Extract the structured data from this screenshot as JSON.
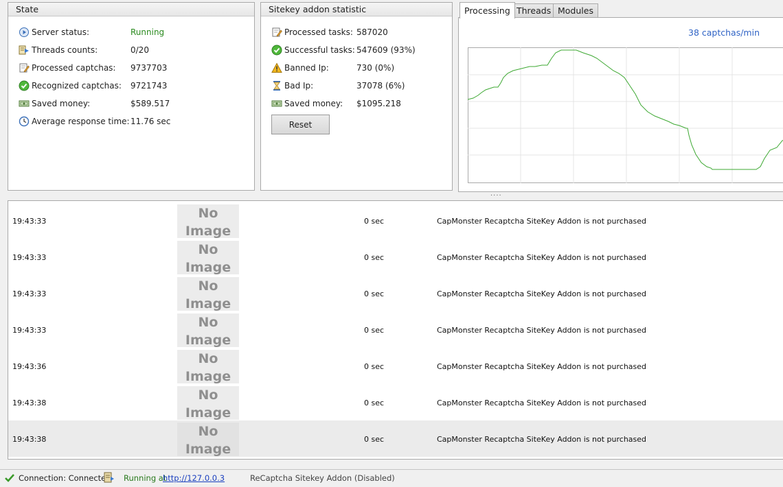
{
  "state": {
    "title": "State",
    "stats": [
      {
        "icon": "play-circle-icon",
        "label": "Server status:",
        "value": "Running"
      },
      {
        "icon": "threads-icon",
        "label": "Threads counts:",
        "value": "0/20"
      },
      {
        "icon": "edit-document-icon",
        "label": "Processed captchas:",
        "value": "9737703"
      },
      {
        "icon": "check-circle-icon",
        "label": "Recognized captchas:",
        "value": "9721743"
      },
      {
        "icon": "money-icon",
        "label": "Saved money:",
        "value": "$589.517"
      },
      {
        "icon": "clock-icon",
        "label": "Average response time:",
        "value": "11.76 sec"
      }
    ]
  },
  "sitekey": {
    "title": "Sitekey addon statistic",
    "stats": [
      {
        "icon": "edit-document-icon",
        "label": "Processed tasks:",
        "value": "587020"
      },
      {
        "icon": "check-circle-icon",
        "label": "Successful tasks:",
        "value": "547609 (93%)"
      },
      {
        "icon": "warning-icon",
        "label": "Banned Ip:",
        "value": "730 (0%)"
      },
      {
        "icon": "hourglass-icon",
        "label": "Bad Ip:",
        "value": "37078 (6%)"
      },
      {
        "icon": "money-icon",
        "label": "Saved money:",
        "value": "$1095.218"
      }
    ],
    "reset_label": "Reset"
  },
  "tabs": [
    {
      "label": "Processing",
      "active": true
    },
    {
      "label": "Threads",
      "active": false
    },
    {
      "label": "Modules",
      "active": false
    }
  ],
  "processing": {
    "rate": "38 captchas/min"
  },
  "splitter": "....",
  "log": {
    "no_image_line1": "No",
    "no_image_line2": "Image",
    "rows": [
      {
        "time": "19:43:33",
        "duration": "0 sec",
        "message": "CapMonster Recaptcha SiteKey Addon is not purchased"
      },
      {
        "time": "19:43:33",
        "duration": "0 sec",
        "message": "CapMonster Recaptcha SiteKey Addon is not purchased"
      },
      {
        "time": "19:43:33",
        "duration": "0 sec",
        "message": "CapMonster Recaptcha SiteKey Addon is not purchased"
      },
      {
        "time": "19:43:33",
        "duration": "0 sec",
        "message": "CapMonster Recaptcha SiteKey Addon is not purchased"
      },
      {
        "time": "19:43:36",
        "duration": "0 sec",
        "message": "CapMonster Recaptcha SiteKey Addon is not purchased"
      },
      {
        "time": "19:43:38",
        "duration": "0 sec",
        "message": "CapMonster Recaptcha SiteKey Addon is not purchased"
      },
      {
        "time": "19:43:38",
        "duration": "0 sec",
        "message": "CapMonster Recaptcha SiteKey Addon is not purchased"
      }
    ],
    "selected_row": 6
  },
  "statusbar": {
    "connection": "Connection: Connected",
    "running_prefix": "Running at",
    "running_url": "http://127.0.0.3",
    "addon": "ReCaptcha Sitekey Addon (Disabled)"
  },
  "colors": {
    "running": "#2a8a1e",
    "graph_line": "#3da832",
    "rate_text": "#2f63c5"
  }
}
